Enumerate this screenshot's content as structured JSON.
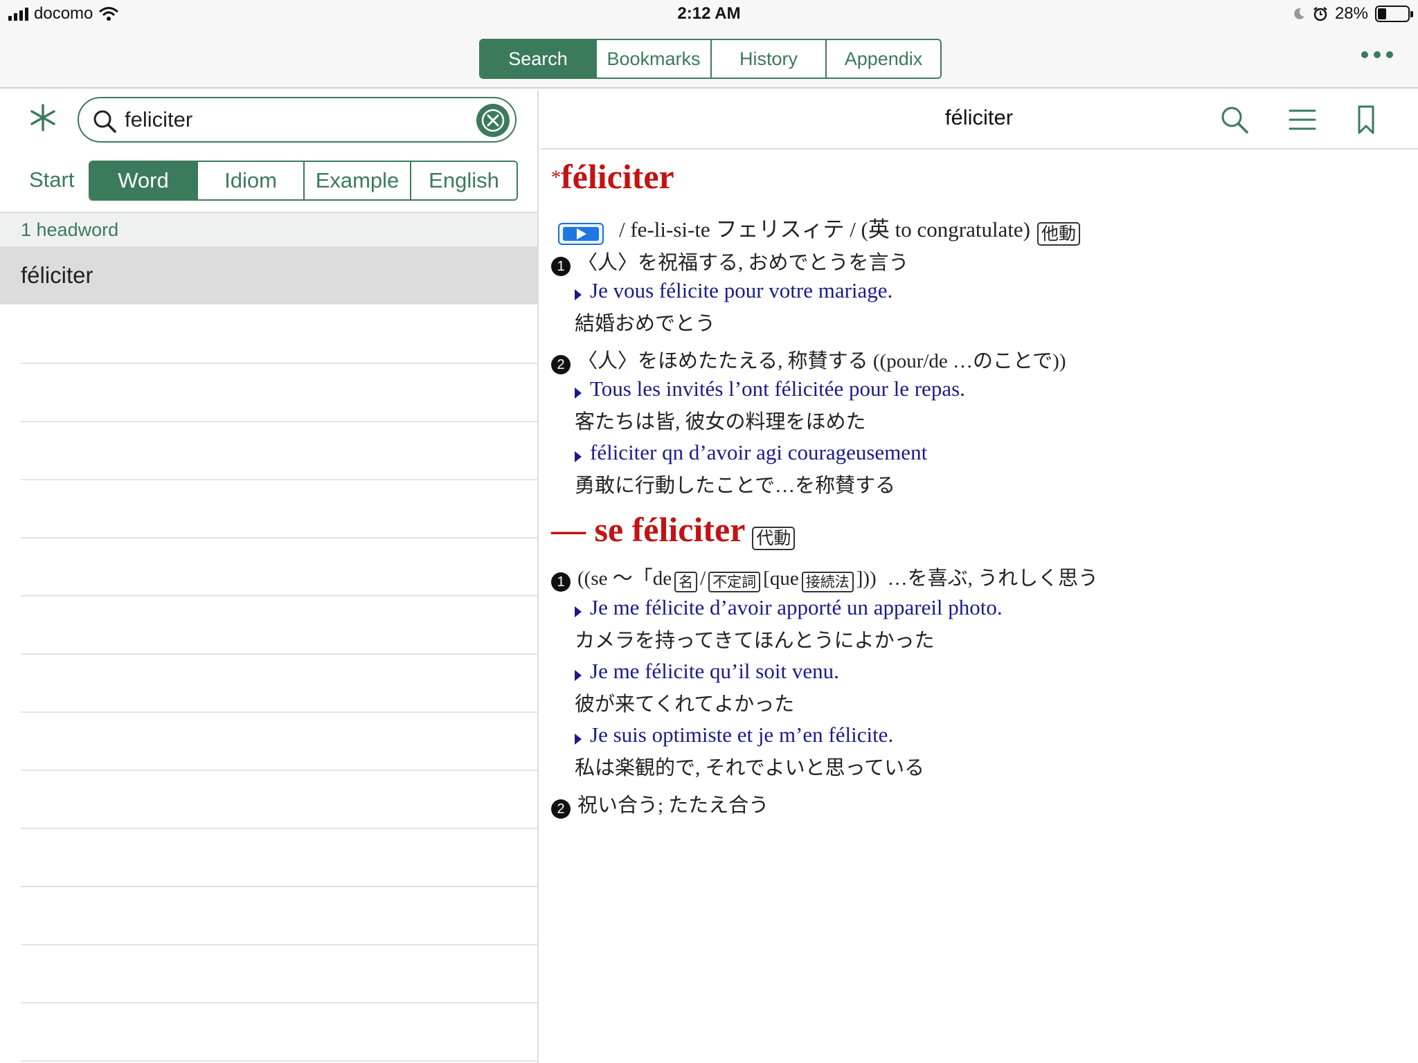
{
  "status_bar": {
    "carrier": "docomo",
    "time": "2:12 AM",
    "battery_percent": "28%",
    "battery_level": 0.28
  },
  "nav": {
    "tabs": [
      {
        "label": "Search",
        "active": true
      },
      {
        "label": "Bookmarks",
        "active": false
      },
      {
        "label": "History",
        "active": false
      },
      {
        "label": "Appendix",
        "active": false
      }
    ]
  },
  "search": {
    "value": "feliciter",
    "placeholder": ""
  },
  "modes": {
    "start_label": "Start",
    "options": [
      "Word",
      "Idiom",
      "Example",
      "English"
    ],
    "active": "Word"
  },
  "results": {
    "count_label": "1 headword",
    "items": [
      "féliciter"
    ]
  },
  "detail": {
    "title": "féliciter",
    "headword": "féliciter",
    "pronunciation": "/ fe-li-si-te フェリスィテ / (英 to congratulate)",
    "pos_tag": "他動",
    "senses": [
      {
        "num": "1",
        "definition": "〈人〉を祝福する, おめでとうを言う",
        "examples": [
          {
            "fr": "Je vous félicite pour votre mariage.",
            "ja": "結婚おめでとう"
          }
        ]
      },
      {
        "num": "2",
        "definition": "〈人〉をほめたたえる, 称賛する ((pour/de …のことで))",
        "examples": [
          {
            "fr": "Tous les invités l’ont félicitée pour le repas.",
            "ja": "客たちは皆, 彼女の料理をほめた"
          },
          {
            "fr": "féliciter qn d’avoir agi courageusement",
            "ja": "勇敢に行動したことで…を称賛する"
          }
        ]
      }
    ],
    "sub_entry": {
      "headword": "— se féliciter",
      "pos_tag": "代動",
      "sense1_pattern_a": "((se ～「de",
      "sense1_tag1": "名",
      "sense1_sep": "/",
      "sense1_tag2": "不定詞",
      "sense1_pattern_b": "[que",
      "sense1_tag3": "接続法",
      "sense1_pattern_c": "]))",
      "sense1_meaning": "…を喜ぶ, うれしく思う",
      "examples": [
        {
          "fr": "Je me félicite d’avoir apporté un appareil photo.",
          "ja": "カメラを持ってきてほんとうによかった"
        },
        {
          "fr": "Je me félicite qu’il soit venu.",
          "ja": "彼が来てくれてよかった"
        },
        {
          "fr": "Je suis optimiste et je m’en félicite.",
          "ja": "私は楽観的で, それでよいと思っている"
        }
      ],
      "sense2": "祝い合う; たたえ合う"
    }
  },
  "colors": {
    "accent": "#3c7a5c",
    "headword": "#c21313",
    "example": "#1a1a8c"
  }
}
